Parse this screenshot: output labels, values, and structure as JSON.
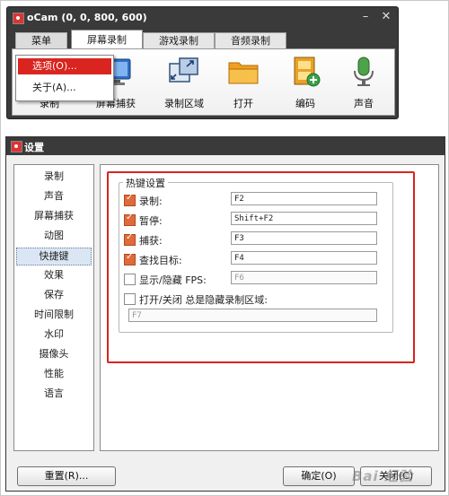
{
  "ocam": {
    "title": "oCam (0, 0, 800, 600)",
    "window_controls": {
      "minimize": "–",
      "close": "✕"
    },
    "menu_tab": "菜单",
    "tabs": [
      {
        "label": "屏幕录制"
      },
      {
        "label": "游戏录制"
      },
      {
        "label": "音频录制"
      }
    ],
    "toolbar": [
      {
        "label": "录制",
        "icon": "record-icon"
      },
      {
        "label": "屏幕捕获",
        "icon": "monitor-icon"
      },
      {
        "label": "录制区域",
        "icon": "region-icon"
      },
      {
        "label": "打开",
        "icon": "folder-icon"
      },
      {
        "label": "编码",
        "icon": "film-icon"
      },
      {
        "label": "声音",
        "icon": "microphone-icon"
      }
    ],
    "dropdown": [
      {
        "label": "选项(O)..."
      },
      {
        "label": "关于(A)..."
      }
    ]
  },
  "settings": {
    "title": "设置",
    "sidebar": [
      {
        "label": "录制"
      },
      {
        "label": "声音"
      },
      {
        "label": "屏幕捕获"
      },
      {
        "label": "动图"
      },
      {
        "label": "快捷键",
        "selected": true
      },
      {
        "label": "效果"
      },
      {
        "label": "保存"
      },
      {
        "label": "时间限制"
      },
      {
        "label": "水印"
      },
      {
        "label": "摄像头"
      },
      {
        "label": "性能"
      },
      {
        "label": "语言"
      }
    ],
    "hotkeys": {
      "group_title": "热键设置",
      "rows": [
        {
          "label": "录制:",
          "checked": true,
          "value": "F2"
        },
        {
          "label": "暂停:",
          "checked": true,
          "value": "Shift+F2"
        },
        {
          "label": "捕获:",
          "checked": true,
          "value": "F3"
        },
        {
          "label": "查找目标:",
          "checked": true,
          "value": "F4"
        },
        {
          "label": "显示/隐藏 FPS:",
          "checked": false,
          "value": "F6"
        }
      ],
      "region_toggle": {
        "label": "打开/关闭 总是隐藏录制区域:",
        "checked": false,
        "value": "F7"
      }
    },
    "buttons": {
      "reset": "重置(R)...",
      "ok": "确定(O)",
      "close": "关闭(C)"
    }
  },
  "watermark": "Bai 经验",
  "colors": {
    "highlight_red": "#d9241f",
    "titlebar": "#3a3a3a",
    "checkbox_checked": "#e06a3a"
  }
}
